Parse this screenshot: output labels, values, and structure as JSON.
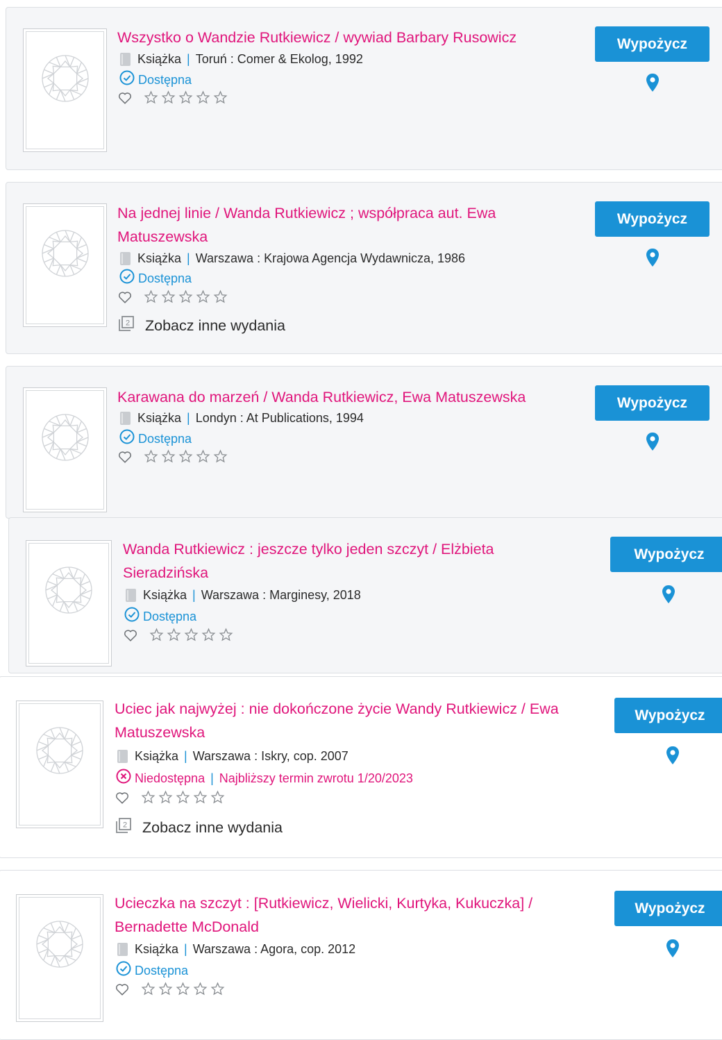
{
  "colors": {
    "accent_pink": "#e0157b",
    "accent_blue": "#1a92d6"
  },
  "common": {
    "borrow_label": "Wypożycz",
    "see_other_editions": "Zobacz inne wydania",
    "separator": "|",
    "editions_badge": "2"
  },
  "results": [
    {
      "title_lines": [
        "Wszystko o Wandzie Rutkiewicz / wywiad Barbary Rusowicz"
      ],
      "type": "Książka",
      "publication": "Toruń : Comer & Ekolog, 1992",
      "status": "Dostępna",
      "available": true,
      "rating_stars": 0,
      "other_editions": false
    },
    {
      "title_lines": [
        "Na jednej linie / Wanda Rutkiewicz ; współpraca aut. Ewa",
        "Matuszewska"
      ],
      "type": "Książka",
      "publication": "Warszawa : Krajowa Agencja Wydawnicza, 1986",
      "status": "Dostępna",
      "available": true,
      "rating_stars": 0,
      "other_editions": true
    },
    {
      "title_lines": [
        "Karawana do marzeń / Wanda Rutkiewicz, Ewa Matuszewska"
      ],
      "type": "Książka",
      "publication": "Londyn : At Publications, 1994",
      "status": "Dostępna",
      "available": true,
      "rating_stars": 0,
      "other_editions": false
    },
    {
      "title_lines": [
        "Wanda Rutkiewicz : jeszcze tylko jeden szczyt / Elżbieta",
        "Sieradzińska"
      ],
      "type": "Książka",
      "publication": "Warszawa : Marginesy, 2018",
      "status": "Dostępna",
      "available": true,
      "rating_stars": 0,
      "other_editions": false
    },
    {
      "title_lines": [
        "Uciec jak najwyżej : nie dokończone życie Wandy Rutkiewicz / Ewa",
        "Matuszewska"
      ],
      "type": "Książka",
      "publication": "Warszawa : Iskry, cop. 2007",
      "status": "Niedostępna",
      "available": false,
      "return_note": "Najbliższy termin zwrotu 1/20/2023",
      "rating_stars": 0,
      "other_editions": true
    },
    {
      "title_lines": [
        "Ucieczka na szczyt : [Rutkiewicz, Wielicki, Kurtyka, Kukuczka] /",
        "Bernadette McDonald"
      ],
      "type": "Książka",
      "publication": "Warszawa : Agora, cop. 2012",
      "status": "Dostępna",
      "available": true,
      "rating_stars": 0,
      "other_editions": false
    }
  ]
}
